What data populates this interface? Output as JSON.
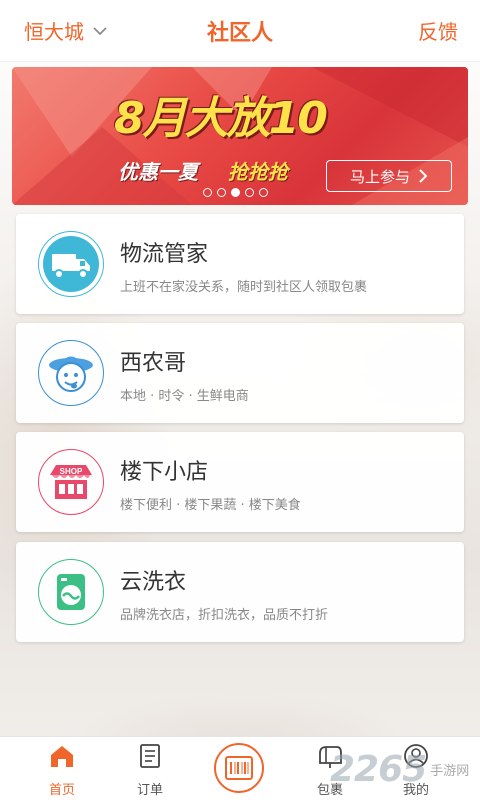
{
  "header": {
    "city": "恒大城",
    "title": "社区人",
    "feedback": "反馈"
  },
  "banner": {
    "headline": "8月大放10",
    "slogan_left": "优惠一夏",
    "slogan_right": "抢抢抢",
    "cta": "马上参与",
    "slide_count": 5,
    "active_slide": 3
  },
  "services": [
    {
      "name": "物流管家",
      "desc": "上班不在家没关系，随时到社区人领取包裹",
      "icon": "truck-icon",
      "color": "#3fb8d8"
    },
    {
      "name": "西农哥",
      "desc": "本地 · 时令 · 生鲜电商",
      "icon": "farmer-icon",
      "color": "#3a8fd6"
    },
    {
      "name": "楼下小店",
      "desc": "楼下便利 · 楼下果蔬 · 楼下美食",
      "icon": "shop-icon",
      "color": "#e8486a"
    },
    {
      "name": "云洗衣",
      "desc": "品牌洗衣店，折扣洗衣，品质不打折",
      "icon": "washer-icon",
      "color": "#3bbf84"
    }
  ],
  "tabs": [
    {
      "label": "首页",
      "icon": "home-icon",
      "active": true
    },
    {
      "label": "订单",
      "icon": "order-icon",
      "active": false
    },
    {
      "label": "",
      "icon": "barcode-scan-icon",
      "active": false
    },
    {
      "label": "包裹",
      "icon": "mailbox-icon",
      "active": false
    },
    {
      "label": "我的",
      "icon": "user-icon",
      "active": false
    }
  ],
  "watermark": {
    "number": "2265",
    "text": "手游网"
  },
  "colors": {
    "accent": "#f0652a",
    "banner": "#e94b45"
  }
}
